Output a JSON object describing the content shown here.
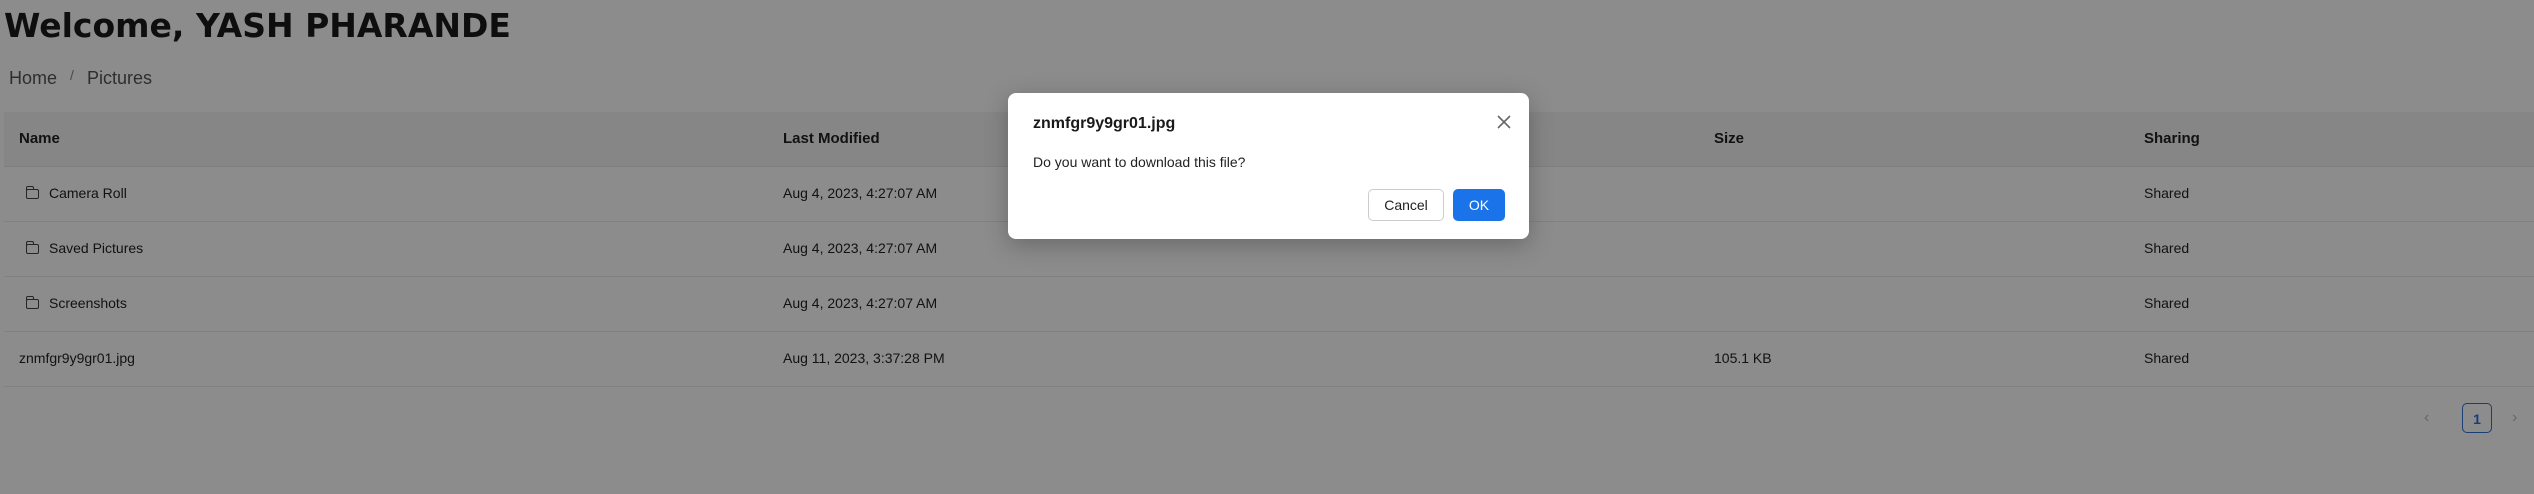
{
  "header": {
    "welcome": "Welcome, YASH PHARANDE"
  },
  "breadcrumb": {
    "items": [
      "Home",
      "Pictures"
    ],
    "separator": "/"
  },
  "table": {
    "columns": [
      "Name",
      "Last Modified",
      "Size",
      "Sharing"
    ],
    "rows": [
      {
        "type": "folder",
        "icon": "folder-icon",
        "name": "Camera Roll",
        "modified": "Aug 4, 2023, 4:27:07 AM",
        "size": "",
        "sharing": "Shared"
      },
      {
        "type": "folder",
        "icon": "folder-icon",
        "name": "Saved Pictures",
        "modified": "Aug 4, 2023, 4:27:07 AM",
        "size": "",
        "sharing": "Shared"
      },
      {
        "type": "folder",
        "icon": "folder-icon",
        "name": "Screenshots",
        "modified": "Aug 4, 2023, 4:27:07 AM",
        "size": "",
        "sharing": "Shared"
      },
      {
        "type": "file",
        "icon": "",
        "name": "znmfgr9y9gr01.jpg",
        "modified": "Aug 11, 2023, 3:37:28 PM",
        "size": "105.1 KB",
        "sharing": "Shared"
      }
    ]
  },
  "pagination": {
    "current": "1",
    "prev_icon": "chevron-left-icon",
    "next_icon": "chevron-right-icon"
  },
  "dialog": {
    "title": "znmfgr9y9gr01.jpg",
    "message": "Do you want to download this file?",
    "cancel_label": "Cancel",
    "ok_label": "OK",
    "close_icon": "close-icon"
  },
  "colors": {
    "accent": "#1a73e8",
    "overlay": "rgba(0,0,0,0.45)"
  }
}
